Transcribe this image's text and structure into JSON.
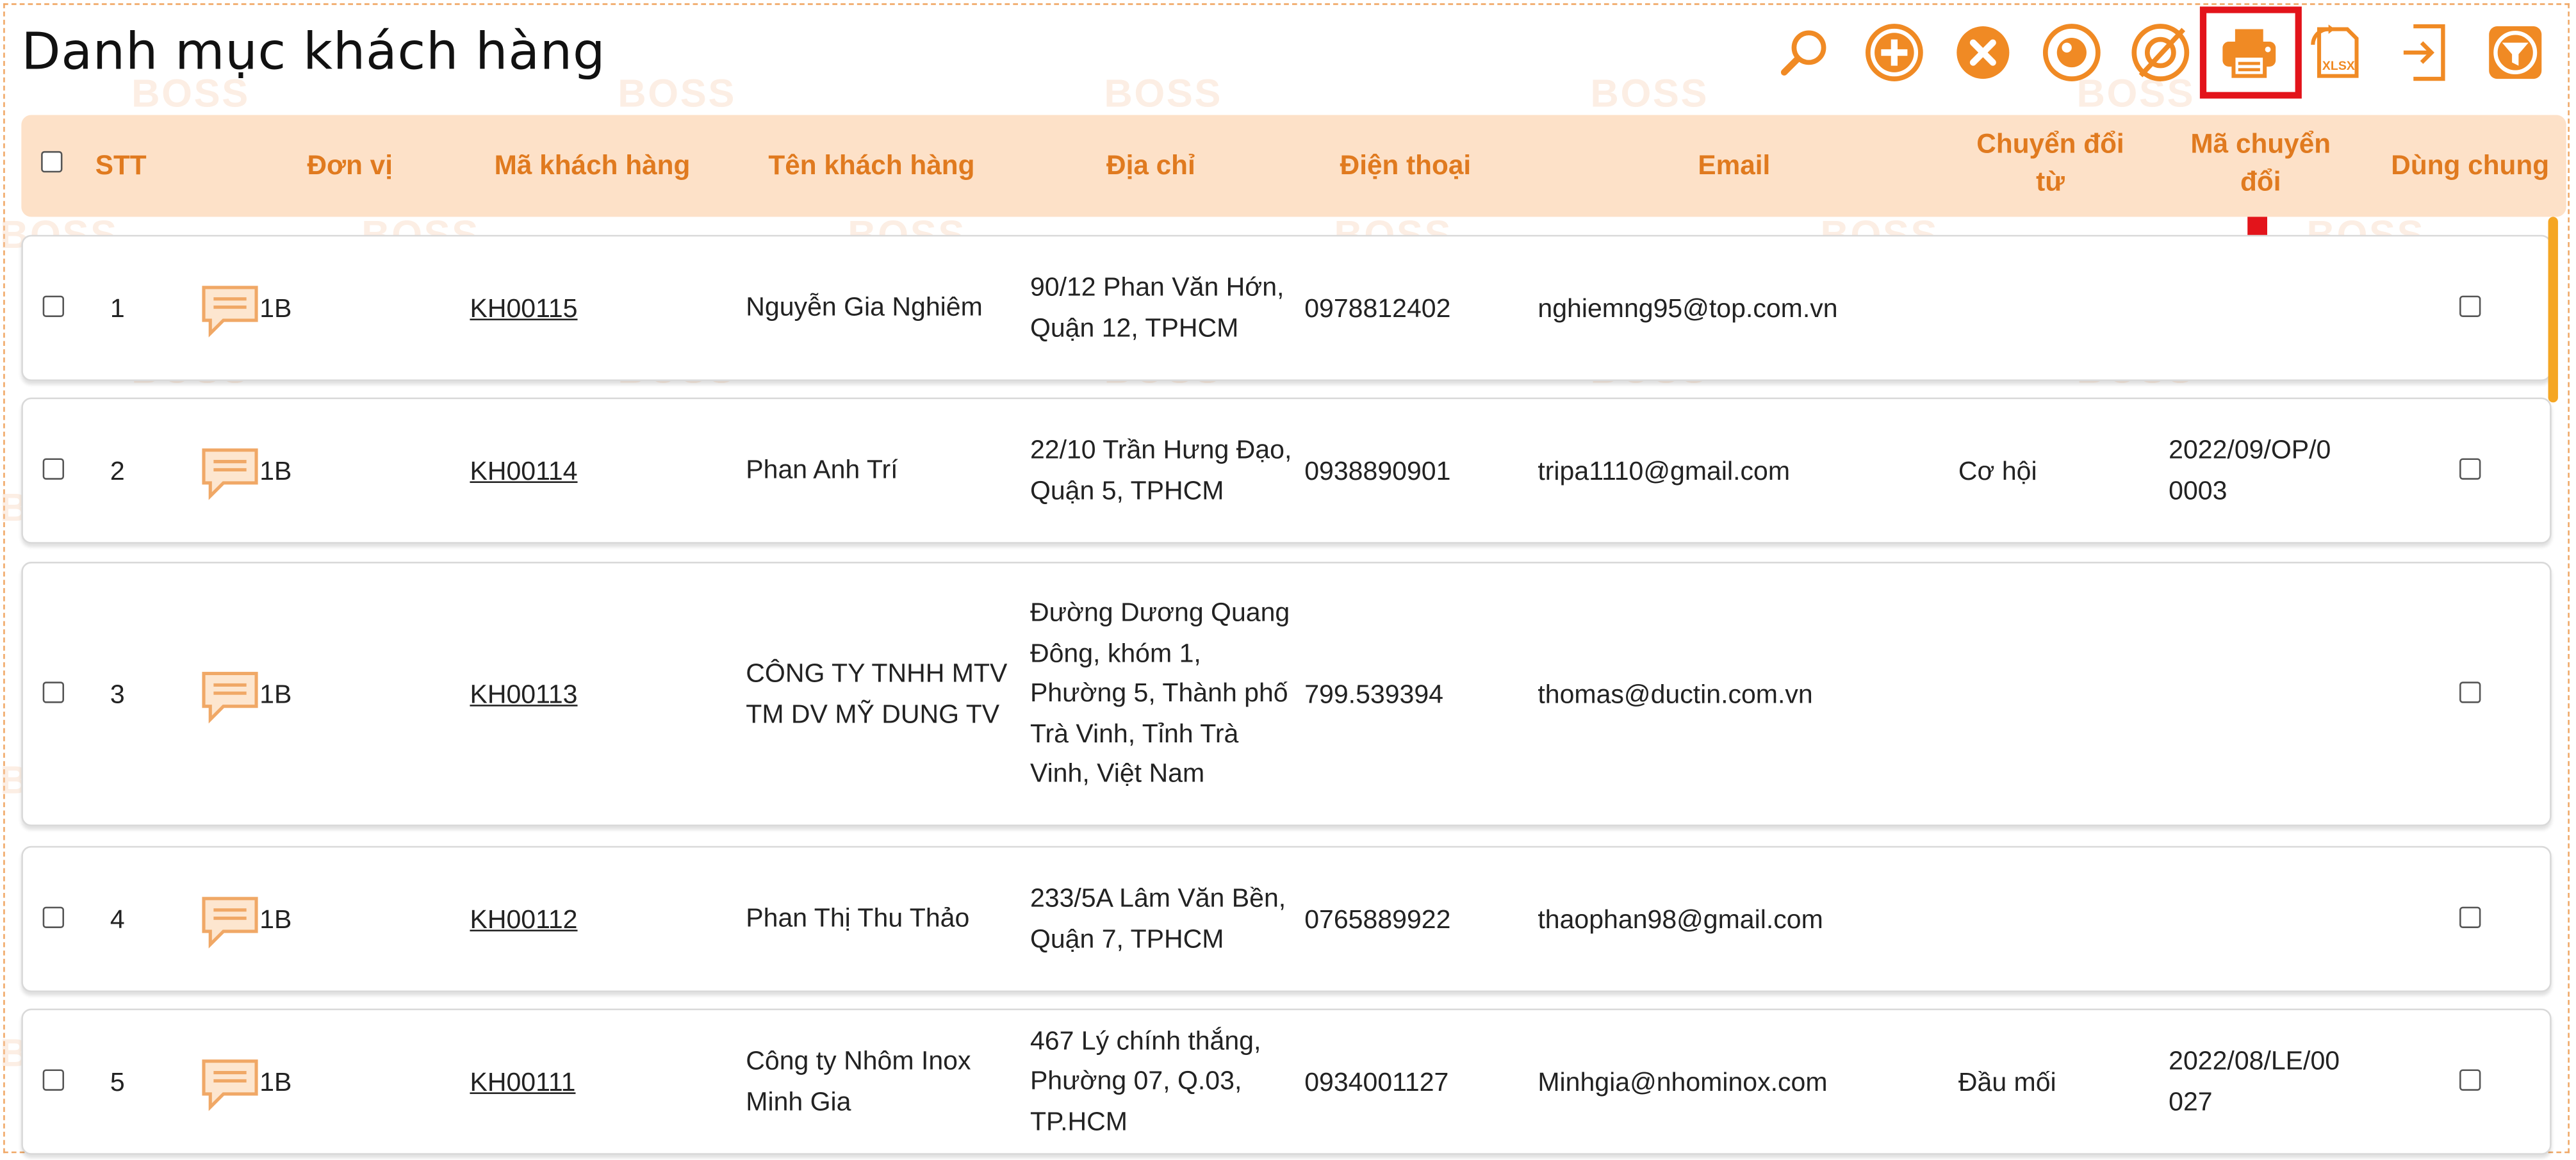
{
  "page": {
    "title": "Danh mục khách hàng"
  },
  "toolbar": {
    "tools": [
      {
        "name": "search-icon",
        "label": "Tìm kiếm"
      },
      {
        "name": "add-icon",
        "label": "Thêm"
      },
      {
        "name": "delete-icon",
        "label": "Xóa"
      },
      {
        "name": "view-icon",
        "label": "Xem"
      },
      {
        "name": "hide-icon",
        "label": "Ẩn"
      },
      {
        "name": "print-icon",
        "label": "In"
      },
      {
        "name": "export-xlsx-icon",
        "label": "XLSX"
      },
      {
        "name": "import-icon",
        "label": "Nhập"
      },
      {
        "name": "filter-icon",
        "label": "Lọc"
      }
    ],
    "accent": "#f08a24",
    "highlight_color": "#e3141b"
  },
  "table": {
    "headers": {
      "stt": "STT",
      "unit": "Đơn vị",
      "code": "Mã khách hàng",
      "name": "Tên khách hàng",
      "address": "Địa chỉ",
      "phone": "Điện thoại",
      "email": "Email",
      "converted_from": "Chuyển đổi từ",
      "conversion_code": "Mã chuyển đổi",
      "shared": "Dùng chung"
    },
    "rows": [
      {
        "stt": "1",
        "unit": "1B",
        "code": "KH00115",
        "name": "Nguyễn Gia Nghiêm",
        "address": "90/12 Phan Văn Hớn, Quận 12, TPHCM",
        "phone": "0978812402",
        "email": "nghiemng95@top.com.vn",
        "converted_from": "",
        "conversion_code": ""
      },
      {
        "stt": "2",
        "unit": "1B",
        "code": "KH00114",
        "name": "Phan Anh Trí",
        "address": "22/10 Trần Hưng Đạo, Quận 5, TPHCM",
        "phone": "0938890901",
        "email": "tripa1110@gmail.com",
        "converted_from": "Cơ hội",
        "conversion_code": "2022/09/OP/00003"
      },
      {
        "stt": "3",
        "unit": "1B",
        "code": "KH00113",
        "name": "CÔNG TY TNHH MTV TM DV MỸ DUNG TV",
        "address": "Đường Dương Quang Đông, khóm 1, Phường 5, Thành phố Trà Vinh, Tỉnh Trà Vinh, Việt Nam",
        "phone": "799.539394",
        "email": "thomas@ductin.com.vn",
        "converted_from": "",
        "conversion_code": ""
      },
      {
        "stt": "4",
        "unit": "1B",
        "code": "KH00112",
        "name": "Phan Thị Thu Thảo",
        "address": "233/5A Lâm Văn Bền, Quận 7, TPHCM",
        "phone": "0765889922",
        "email": "thaophan98@gmail.com",
        "converted_from": "",
        "conversion_code": ""
      },
      {
        "stt": "5",
        "unit": "1B",
        "code": "KH00111",
        "name": "Công ty Nhôm Inox Minh Gia",
        "address": "467 Lý chính thắng, Phường 07, Q.03, TP.HCM",
        "phone": "0934001127",
        "email": "Minhgia@nhominox.com",
        "converted_from": "Đầu mối",
        "conversion_code": "2022/08/LE/00027"
      }
    ]
  },
  "watermark": "BOSS"
}
